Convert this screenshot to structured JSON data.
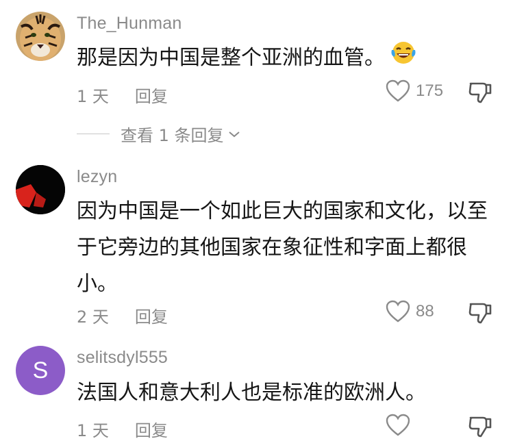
{
  "comments": [
    {
      "username": "The_Hunman",
      "text": "那是因为中国是整个亚洲的血管。",
      "emoji": "laughing-tears",
      "time": "1 天",
      "reply": "回复",
      "likes": "175"
    },
    {
      "username": "lezyn",
      "text_lines": [
        "因为中国是一个如此巨大的国家和文化，以至",
        "于它旁边的其他国家在象征性和字面上都很",
        "小。"
      ],
      "time": "2 天",
      "reply": "回复",
      "likes": "88"
    },
    {
      "username": "selitsdyl555",
      "avatar_letter": "S",
      "text": "法国人和意大利人也是标准的欧洲人。",
      "time": "1 天",
      "reply": "回复",
      "likes": ""
    }
  ],
  "view_replies": "查看 1 条回复",
  "colors": {
    "avatar_purple": "#8c5cc8",
    "meta_gray": "#8a8a8a",
    "text": "#161616"
  }
}
